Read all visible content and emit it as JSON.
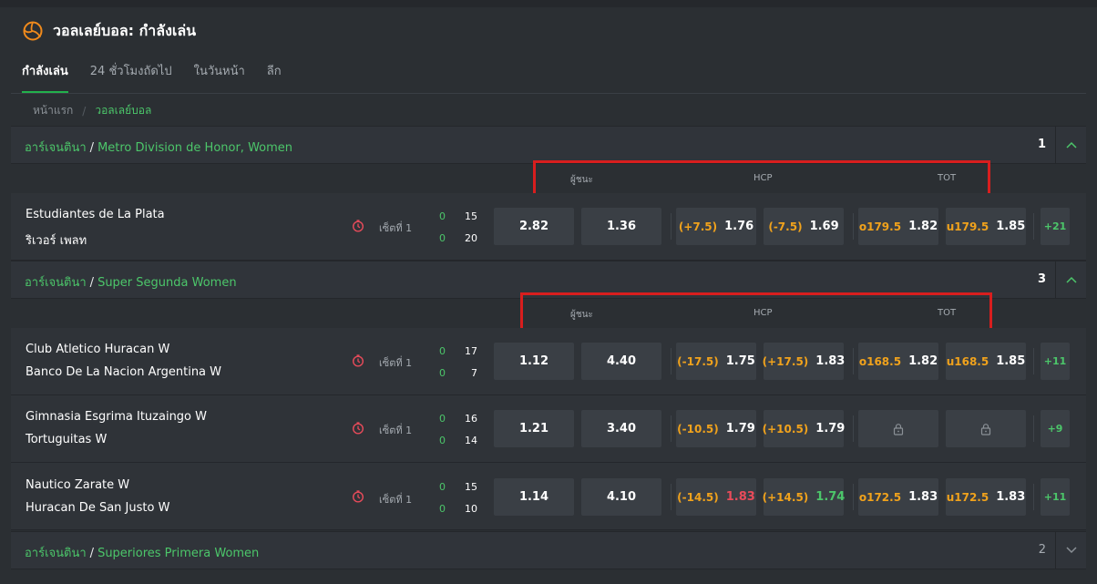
{
  "page": {
    "title": "วอลเลย์บอล: กำลังเล่น",
    "title_icon": "volleyball-icon",
    "accent": "#22b14c"
  },
  "tabs": [
    "กำลังเล่น",
    "24 ชั่วโมงถัดไป",
    "ในวันหน้า",
    "ลีก"
  ],
  "breadcrumb": {
    "home": "หน้าแรก",
    "current": "วอลเลย์บอล"
  },
  "markets": {
    "winner": "ผู้ชนะ",
    "hcp": "HCP",
    "tot": "TOT"
  },
  "leagues": [
    {
      "country": "อาร์เจนตินา",
      "name": "Metro Division de Honor, Women",
      "count": "1",
      "chevron": "chevron-up-icon",
      "matches": [
        {
          "home": "Estudiantes de La Plata",
          "away": "ริเวอร์ เพลท",
          "period": "เซ็ตที่ 1",
          "sets": [
            "0",
            "0"
          ],
          "points": [
            "15",
            "20"
          ],
          "win1": "2.82",
          "win2": "1.36",
          "hcp1": {
            "line": "(+7.5)",
            "odd": "1.76"
          },
          "hcp2": {
            "line": "(-7.5)",
            "odd": "1.69"
          },
          "tot1": {
            "line": "o179.5",
            "odd": "1.82"
          },
          "tot2": {
            "line": "u179.5",
            "odd": "1.85"
          },
          "more": "+21"
        }
      ]
    },
    {
      "country": "อาร์เจนตินา",
      "name": "Super Segunda Women",
      "count": "3",
      "chevron": "chevron-up-icon",
      "matches": [
        {
          "home": "Club Atletico Huracan W",
          "away": "Banco De La Nacion Argentina W",
          "period": "เซ็ตที่ 1",
          "sets": [
            "0",
            "0"
          ],
          "points": [
            "17",
            "7"
          ],
          "win1": "1.12",
          "win2": "4.40",
          "hcp1": {
            "line": "(-17.5)",
            "odd": "1.75"
          },
          "hcp2": {
            "line": "(+17.5)",
            "odd": "1.83"
          },
          "tot1": {
            "line": "o168.5",
            "odd": "1.82"
          },
          "tot2": {
            "line": "u168.5",
            "odd": "1.85"
          },
          "more": "+11"
        },
        {
          "home": "Gimnasia Esgrima Ituzaingo W",
          "away": "Tortuguitas W",
          "period": "เซ็ตที่ 1",
          "sets": [
            "0",
            "0"
          ],
          "points": [
            "16",
            "14"
          ],
          "win1": "1.21",
          "win2": "3.40",
          "hcp1": {
            "line": "(-10.5)",
            "odd": "1.79"
          },
          "hcp2": {
            "line": "(+10.5)",
            "odd": "1.79"
          },
          "tot_locked": true,
          "lock_icon": "lock-icon",
          "more": "+9"
        },
        {
          "home": "Nautico Zarate W",
          "away": "Huracan De San Justo W",
          "period": "เซ็ตที่ 1",
          "sets": [
            "0",
            "0"
          ],
          "points": [
            "15",
            "10"
          ],
          "win1": "1.14",
          "win2": "4.10",
          "hcp1": {
            "line": "(-14.5)",
            "odd": "1.83",
            "trend": "down"
          },
          "hcp2": {
            "line": "(+14.5)",
            "odd": "1.74",
            "trend": "up"
          },
          "tot1": {
            "line": "o172.5",
            "odd": "1.83"
          },
          "tot2": {
            "line": "u172.5",
            "odd": "1.83"
          },
          "more": "+11"
        }
      ]
    },
    {
      "country": "อาร์เจนตินา",
      "name": "Superiores Primera Women",
      "count": "2",
      "chevron": "chevron-down-icon"
    }
  ],
  "colors": {
    "odd_up": "#4cc66a",
    "odd_down": "#e84b5a",
    "line": "#f0a21c",
    "highlight_box": "#d81e1e"
  }
}
